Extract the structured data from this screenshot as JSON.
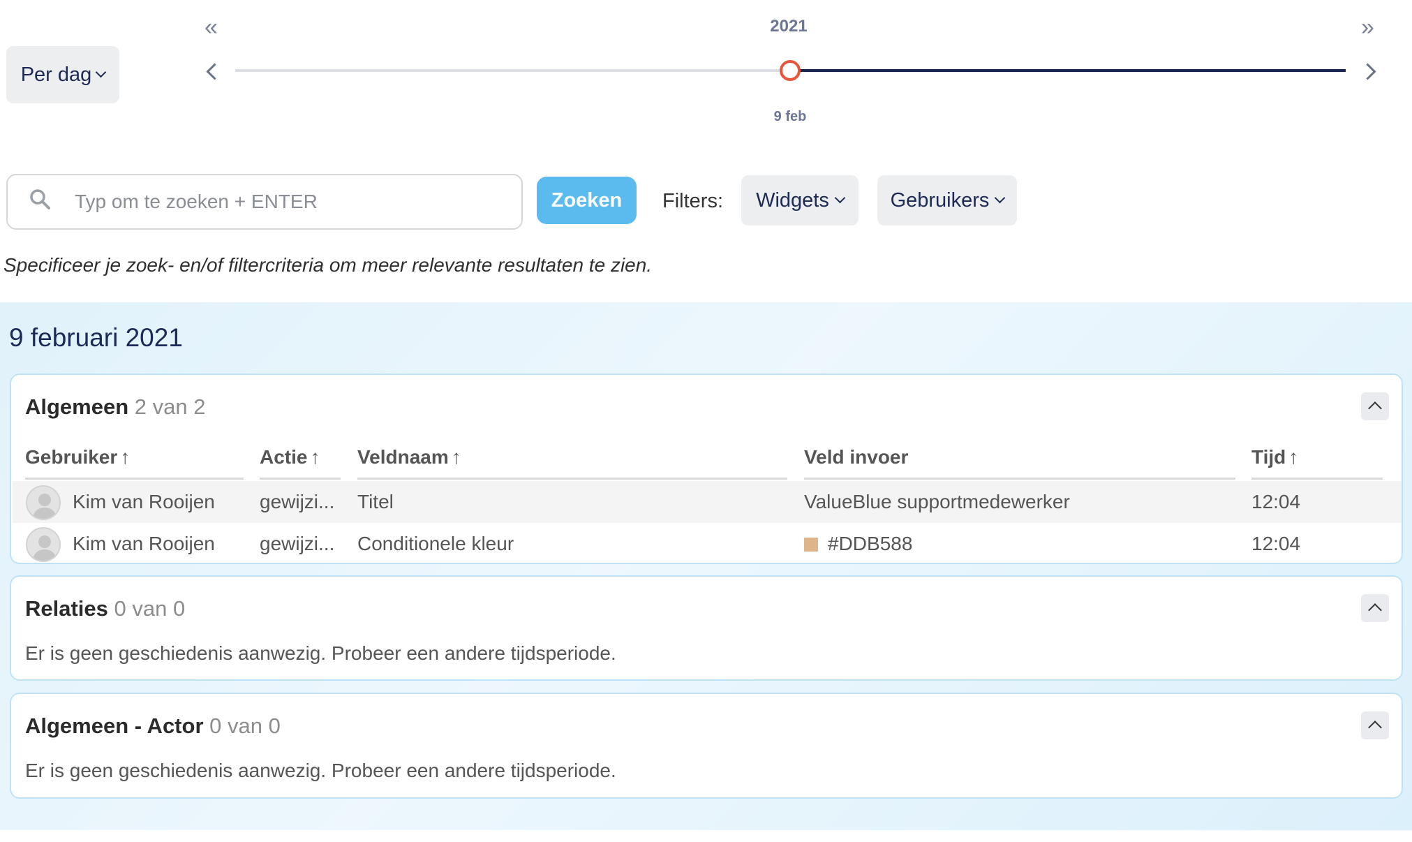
{
  "period": {
    "label": "Per dag"
  },
  "timeline": {
    "year": "2021",
    "selected_date": "9 feb",
    "first_label": "«",
    "last_label": "»",
    "progress": 0.5
  },
  "search": {
    "placeholder": "Typ om te zoeken + ENTER",
    "value": "",
    "button_label": "Zoeken"
  },
  "filters": {
    "label": "Filters:",
    "widgets_label": "Widgets",
    "users_label": "Gebruikers"
  },
  "hint": "Specificeer je zoek- en/of filtercriteria om meer relevante resultaten te zien.",
  "day": {
    "title": "9 februari 2021",
    "sections": [
      {
        "name": "Algemeen",
        "count": "2 van 2",
        "columns": [
          "Gebruiker",
          "Actie",
          "Veldnaam",
          "Veld invoer",
          "Tijd"
        ],
        "rows": [
          {
            "user": "Kim van Rooijen",
            "action": "gewijzi...",
            "field": "Titel",
            "value": "ValueBlue supportmedewerker",
            "time": "12:04",
            "swatch": ""
          },
          {
            "user": "Kim van Rooijen",
            "action": "gewijzi...",
            "field": "Conditionele kleur",
            "value": "#DDB588",
            "time": "12:04",
            "swatch": "#DDB588"
          }
        ]
      },
      {
        "name": "Relaties",
        "count": "0 van 0",
        "empty": "Er is geen geschiedenis aanwezig. Probeer een andere tijdsperiode."
      },
      {
        "name": "Algemeen - Actor",
        "count": "0 van 0",
        "empty": "Er is geen geschiedenis aanwezig. Probeer een andere tijdsperiode."
      }
    ]
  },
  "colors": {
    "accent": "#5bbbef",
    "handle": "#e7553a",
    "track_active": "#1a2550"
  }
}
